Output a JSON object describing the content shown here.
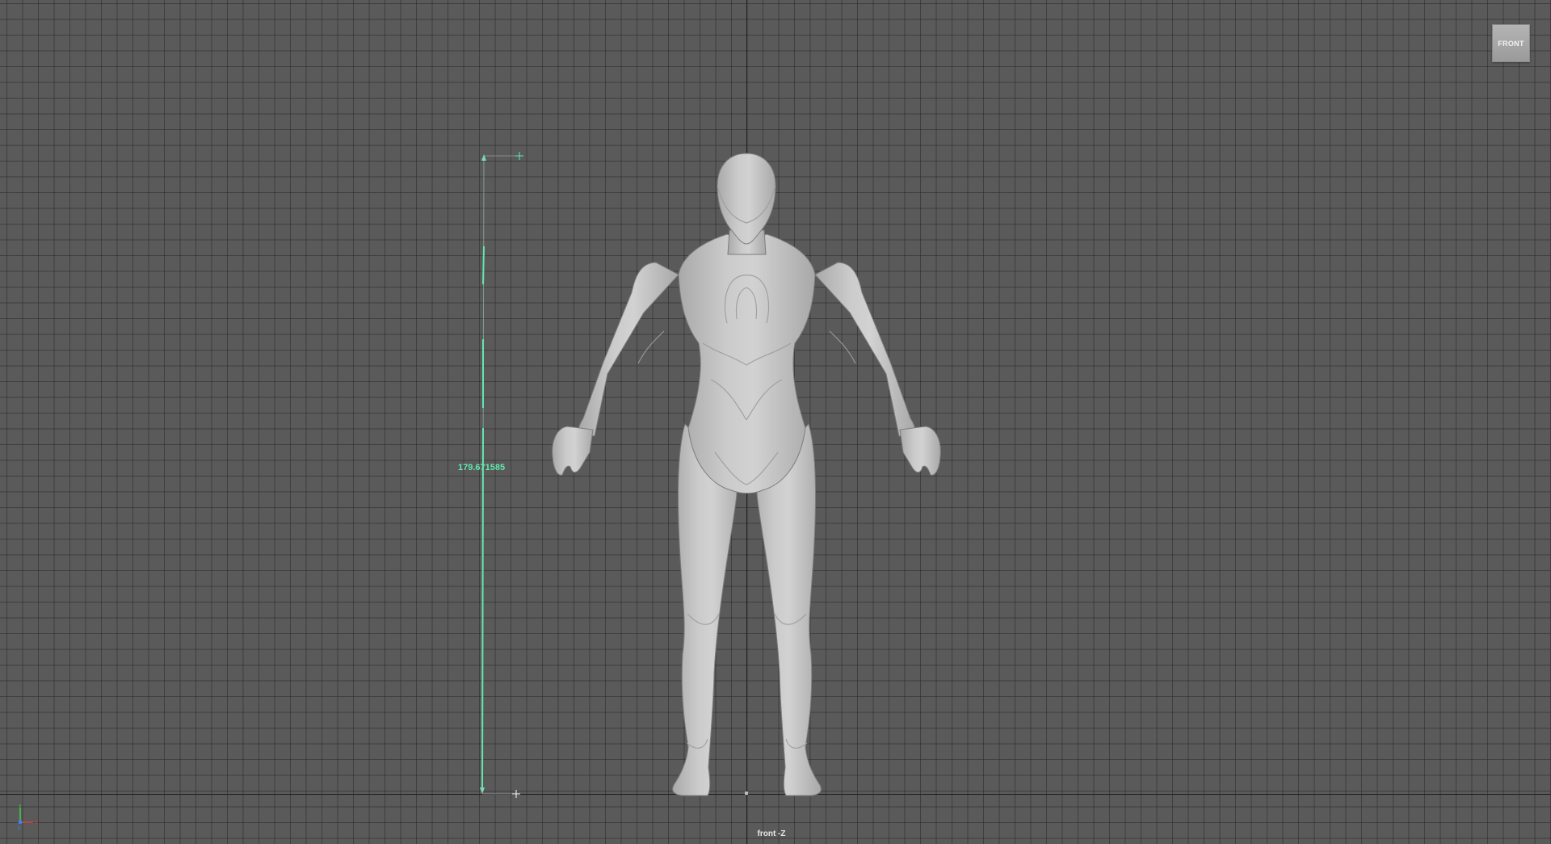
{
  "viewport": {
    "camera_label": "front -Z",
    "grid": "on",
    "background_color": "#5a5a5a"
  },
  "view_cube": {
    "label": "FRONT"
  },
  "measure_tool": {
    "value": "179.671585",
    "color": "#63e6b0"
  },
  "axis_gizmo": {
    "icon": "axis-gizmo-icon",
    "x_color": "#e04040",
    "y_color": "#40d040",
    "z_color": "#4080ff"
  },
  "model": {
    "icon": "humanoid-model",
    "color": "#c4c4c4"
  }
}
